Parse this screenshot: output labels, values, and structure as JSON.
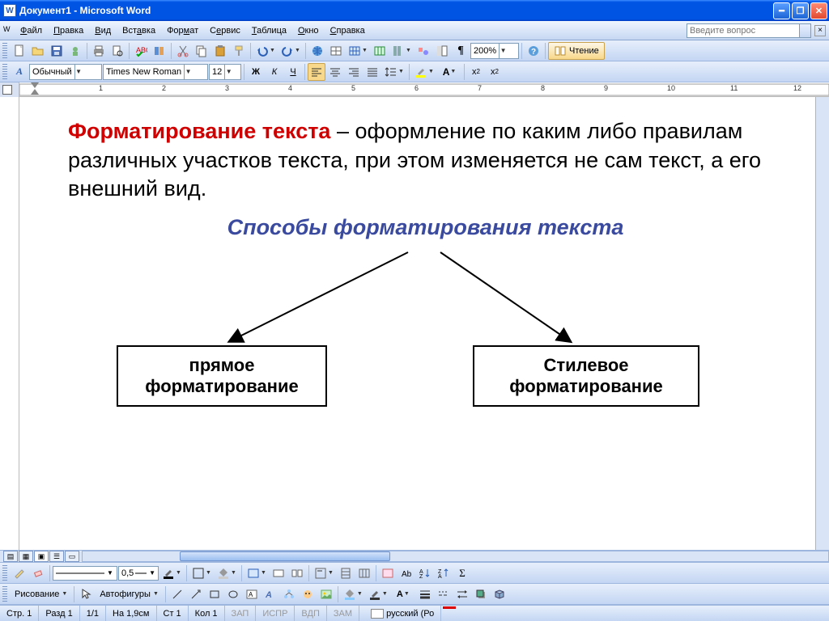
{
  "title": "Документ1 - Microsoft Word",
  "menu": {
    "file": "Файл",
    "edit": "Правка",
    "view": "Вид",
    "insert": "Вставка",
    "format": "Формат",
    "service": "Сервис",
    "table": "Таблица",
    "window": "Окно",
    "help": "Справка"
  },
  "askbox_placeholder": "Введите вопрос",
  "std_toolbar": {
    "zoom": "200%",
    "readmode": "Чтение"
  },
  "fmt_toolbar": {
    "style": "Обычный",
    "font": "Times New Roman",
    "size": "12",
    "bold": "Ж",
    "italic": "К",
    "underline": "Ч"
  },
  "ruler_numbers": [
    "1",
    "2",
    "3",
    "4",
    "5",
    "6",
    "7",
    "8",
    "9",
    "10",
    "11",
    "12"
  ],
  "document": {
    "heading_red": "Форматирование текста",
    "heading_tail": " – оформление по каким либо правилам различных участков текста, при этом изменяется не сам текст, а его внешний вид.",
    "subhead": "Способы форматирования текста",
    "box1_l1": "прямое",
    "box1_l2": "форматирование",
    "box2_l1": "Стилевое",
    "box2_l2": "форматирование"
  },
  "tb3": {
    "lineweight": "0,5"
  },
  "tb4": {
    "drawlabel": "Рисование",
    "autoshapes": "Автофигуры"
  },
  "status": {
    "page": "Стр. 1",
    "section": "Разд 1",
    "pages": "1/1",
    "at": "На 1,9см",
    "line": "Ст 1",
    "col": "Кол 1",
    "rec": "ЗАП",
    "trk": "ИСПР",
    "ext": "ВДП",
    "ovr": "ЗАМ",
    "lang": "русский (Ро"
  }
}
